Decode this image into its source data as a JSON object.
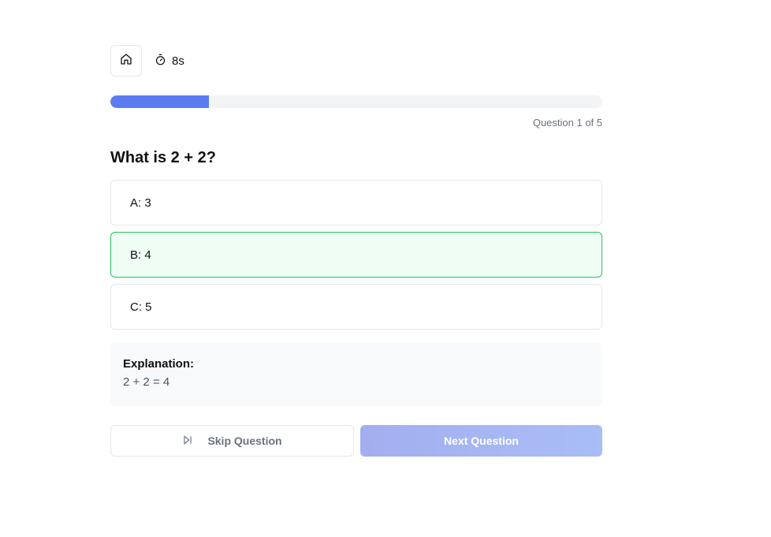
{
  "header": {
    "home_icon": "home-icon",
    "timer_icon": "stopwatch-icon",
    "timer_value": "8s"
  },
  "progress": {
    "fraction": 0.2,
    "fill_color": "#5b7cf0",
    "label": "Question 1 of 5"
  },
  "question": {
    "text": "What is 2 + 2?"
  },
  "options": [
    {
      "label": "A: 3",
      "state": "default"
    },
    {
      "label": "B: 4",
      "state": "correct"
    },
    {
      "label": "C: 5",
      "state": "default"
    }
  ],
  "explanation": {
    "title": "Explanation:",
    "text": "2 + 2 = 4"
  },
  "actions": {
    "skip_label": "Skip Question",
    "skip_icon": "skip-forward-icon",
    "next_label": "Next Question"
  },
  "colors": {
    "correct_bg": "#f0fdf4",
    "correct_border": "#22c55e",
    "next_button": "#a3aef0"
  }
}
